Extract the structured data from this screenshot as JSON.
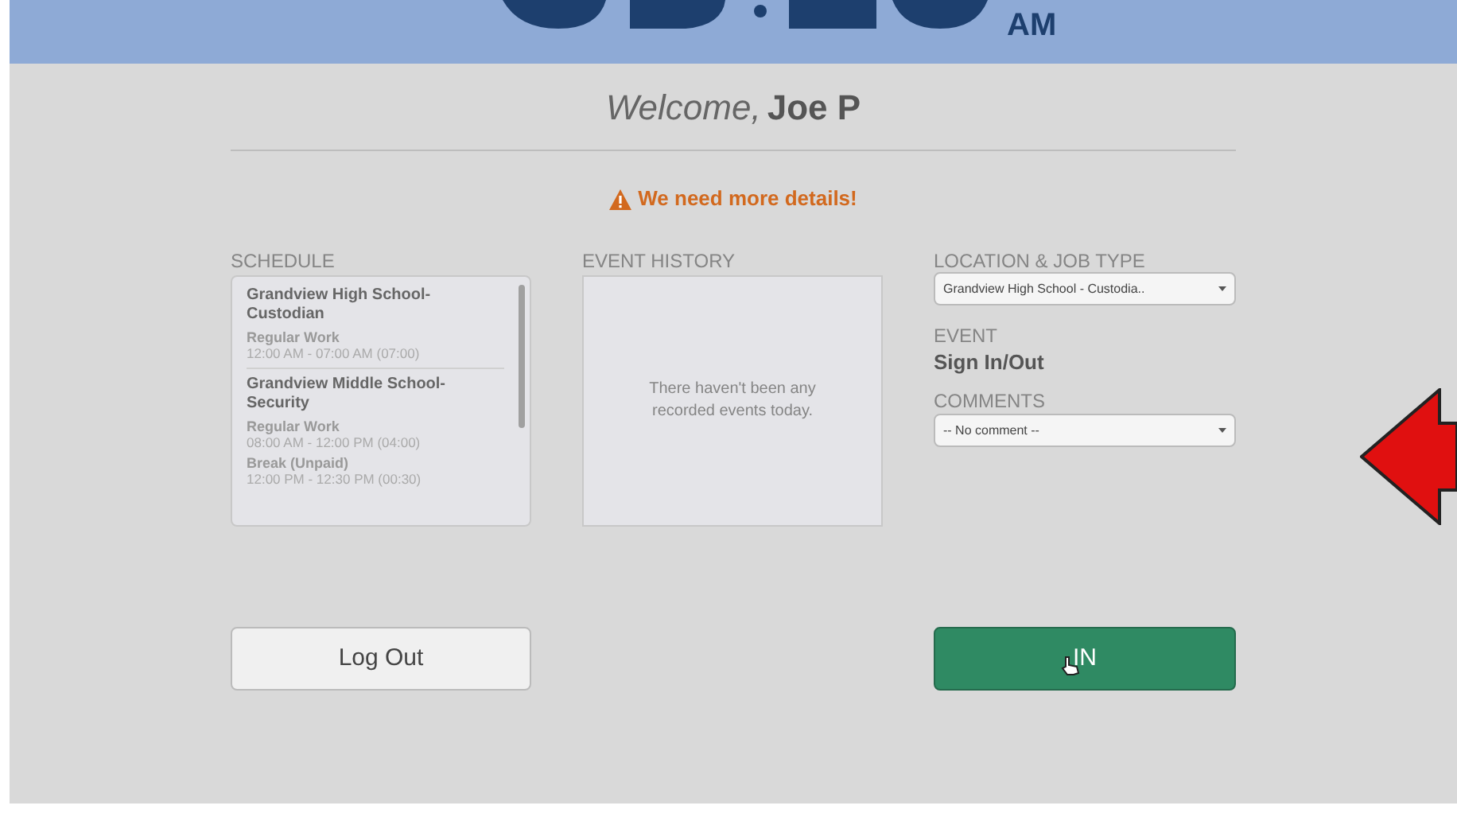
{
  "header": {
    "clock_suffix": "AM"
  },
  "welcome": {
    "greeting": "Welcome,",
    "name": "Joe P"
  },
  "alert": {
    "text": "We need more details!"
  },
  "schedule": {
    "label": "SCHEDULE",
    "blocks": [
      {
        "title": "Grandview High School-Custodian",
        "entries": [
          {
            "type": "Regular Work",
            "time": "12:00 AM - 07:00 AM (07:00)"
          }
        ]
      },
      {
        "title": "Grandview Middle School-Security",
        "entries": [
          {
            "type": "Regular Work",
            "time": "08:00 AM - 12:00 PM (04:00)"
          },
          {
            "type": "Break (Unpaid)",
            "time": "12:00 PM - 12:30 PM (00:30)"
          }
        ]
      }
    ]
  },
  "event_history": {
    "label": "EVENT HISTORY",
    "empty_message": "There haven't been any recorded events today."
  },
  "location": {
    "label": "LOCATION & JOB TYPE",
    "value": "Grandview High School - Custodia.."
  },
  "event": {
    "label": "EVENT",
    "value": "Sign In/Out"
  },
  "comments": {
    "label": "COMMENTS",
    "value": "-- No comment --"
  },
  "buttons": [
    {
      "label": "Log Out",
      "kind": "secondary"
    },
    {
      "label": "IN",
      "kind": "primary"
    }
  ]
}
